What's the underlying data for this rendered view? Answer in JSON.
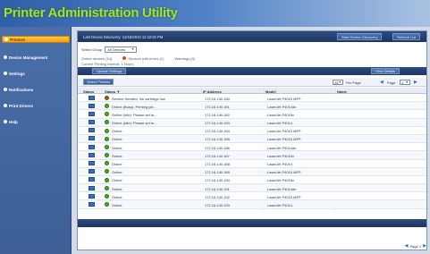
{
  "app": {
    "title": "Printer Administration Utility"
  },
  "sidebar": {
    "items": [
      {
        "label": "Printers",
        "active": true
      },
      {
        "label": "Device Management",
        "active": false
      },
      {
        "label": "Settings",
        "active": false
      },
      {
        "label": "Notifications",
        "active": false
      },
      {
        "label": "Print Drivers",
        "active": false
      },
      {
        "label": "Help",
        "active": false
      }
    ]
  },
  "header": {
    "last_refresh": "Last Device Discovery: 12/15/2010 11:32:02 PM",
    "discover_btn": "Start Device Discovery",
    "refresh_btn": "Refresh List"
  },
  "filter": {
    "label": "Select Group",
    "value": "All Devices"
  },
  "status_summary": {
    "online": "Online devices (14)",
    "error": "Devices with errors (1)",
    "warnings": "Warnings (0)"
  },
  "default_text": "Current Printing Interval: 1 Hours",
  "section": {
    "update_btn": "Update Settings",
    "view_btn": "View Details"
  },
  "pager": {
    "select_btn": "Select Printers",
    "per_page": "25",
    "per_page_label": "Per Page",
    "page_label": "Page",
    "page_value": "1",
    "footer_page_label": "Page 1"
  },
  "table": {
    "columns": [
      "Status",
      "Status ▼",
      "IP Address",
      "Model",
      "Name"
    ],
    "rows": [
      {
        "status": "Service Needed: Ink cartridge low",
        "ip": "172.16.140.180",
        "model": "LaserJet P4015 MFP",
        "name": "",
        "color": "#e03a1a"
      },
      {
        "status": "Online (Busy): Printing job...",
        "ip": "172.16.140.181",
        "model": "LaserJet P4014dn",
        "name": "",
        "color": "#3fb81e"
      },
      {
        "status": "Online (Idle): Please set to...",
        "ip": "172.16.140.182",
        "model": "LaserJet P4015x",
        "name": "",
        "color": "#3fb81e"
      },
      {
        "status": "Online (Idle): Please set to...",
        "ip": "172.16.140.183",
        "model": "LaserJet P4014",
        "name": "",
        "color": "#3fb81e"
      },
      {
        "status": "Online",
        "ip": "172.16.140.184",
        "model": "LaserJet P4015 MFP",
        "name": "",
        "color": "#3fb81e"
      },
      {
        "status": "Online",
        "ip": "172.16.140.185",
        "model": "LaserJet P4015 MFP",
        "name": "",
        "color": "#3fb81e"
      },
      {
        "status": "Online",
        "ip": "172.16.140.186",
        "model": "LaserJet P4014dn",
        "name": "",
        "color": "#3fb81e"
      },
      {
        "status": "Online",
        "ip": "172.16.140.187",
        "model": "LaserJet P4015x",
        "name": "",
        "color": "#3fb81e"
      },
      {
        "status": "Online",
        "ip": "172.16.140.188",
        "model": "LaserJet P4014",
        "name": "",
        "color": "#3fb81e"
      },
      {
        "status": "Online",
        "ip": "172.16.140.189",
        "model": "LaserJet P4015 MFP",
        "name": "",
        "color": "#3fb81e"
      },
      {
        "status": "Online",
        "ip": "172.16.140.190",
        "model": "LaserJet P4015x",
        "name": "",
        "color": "#3fb81e"
      },
      {
        "status": "Online",
        "ip": "172.16.140.191",
        "model": "LaserJet P4014dn",
        "name": "",
        "color": "#3fb81e"
      },
      {
        "status": "Online",
        "ip": "172.16.140.192",
        "model": "LaserJet P4015 MFP",
        "name": "",
        "color": "#3fb81e"
      },
      {
        "status": "Online",
        "ip": "172.16.140.193",
        "model": "LaserJet P4014",
        "name": "",
        "color": "#3fb81e"
      }
    ]
  }
}
